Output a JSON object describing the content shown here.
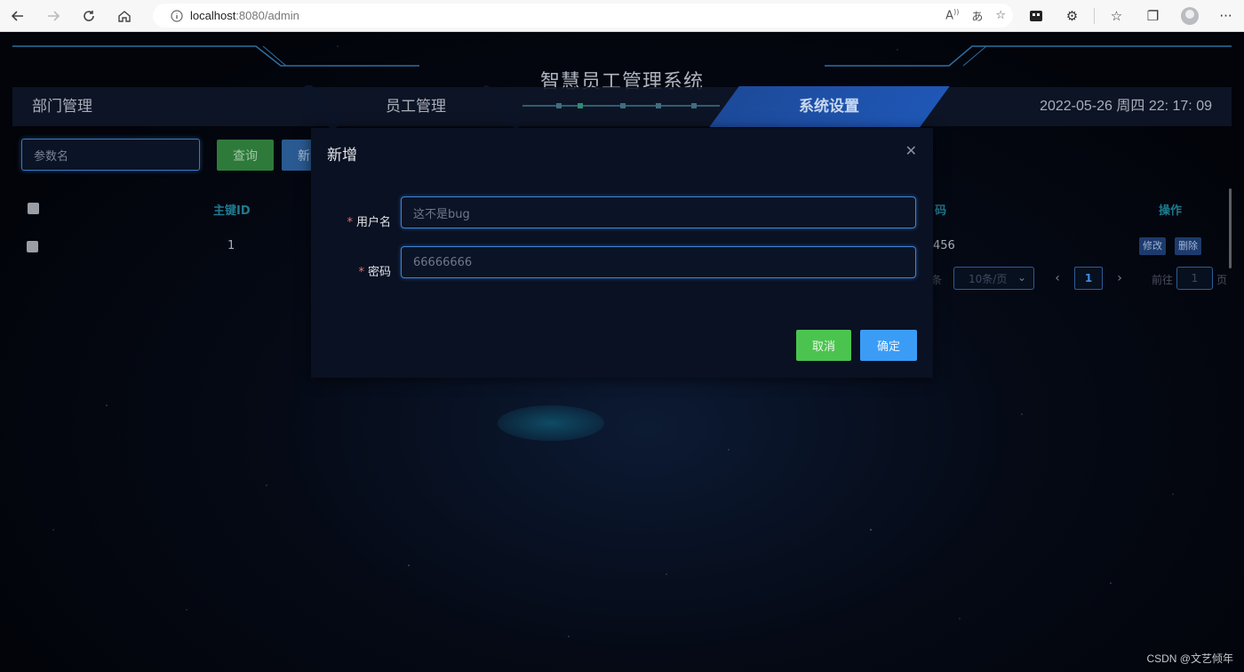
{
  "browser": {
    "url_host": "localhost",
    "url_rest": ":8080/admin",
    "icons": [
      "back-icon",
      "forward-icon",
      "refresh-icon",
      "home-icon",
      "info-icon",
      "read-aloud-icon",
      "translate-icon",
      "favorite-add-icon",
      "workspace-icon",
      "extensions-icon",
      "favorites-icon",
      "collections-icon",
      "profile-icon",
      "more-icon"
    ]
  },
  "header": {
    "system_title": "智慧员工管理系统",
    "nav": [
      "部门管理",
      "员工管理",
      "系统设置"
    ],
    "active_nav": "系统设置",
    "clock": "2022-05-26 周四 22: 17: 09"
  },
  "toolbar": {
    "search_placeholder": "参数名",
    "query_label": "查询",
    "add_label": "新"
  },
  "table": {
    "headers": {
      "id": "主键ID",
      "col3_partial": "码",
      "ops": "操作"
    },
    "rows": [
      {
        "id": "1",
        "col3_partial": "456",
        "edit": "修改",
        "delete": "删除"
      }
    ]
  },
  "pagination": {
    "total_suffix": "条",
    "page_size": "10条/页",
    "current_page": "1",
    "goto_label": "前往",
    "goto_value": "1",
    "page_suffix": "页"
  },
  "dialog": {
    "title": "新增",
    "fields": [
      {
        "label": "用户名",
        "value": "这不是bug"
      },
      {
        "label": "密码",
        "value": "66666666"
      }
    ],
    "cancel_label": "取消",
    "confirm_label": "确定"
  },
  "watermark": "CSDN @文艺倾年",
  "colors": {
    "accent_blue": "#3a9cf5",
    "cancel_green": "#4bc44f",
    "required_red": "#f56c6c",
    "nav_active": "#1f57b6"
  }
}
